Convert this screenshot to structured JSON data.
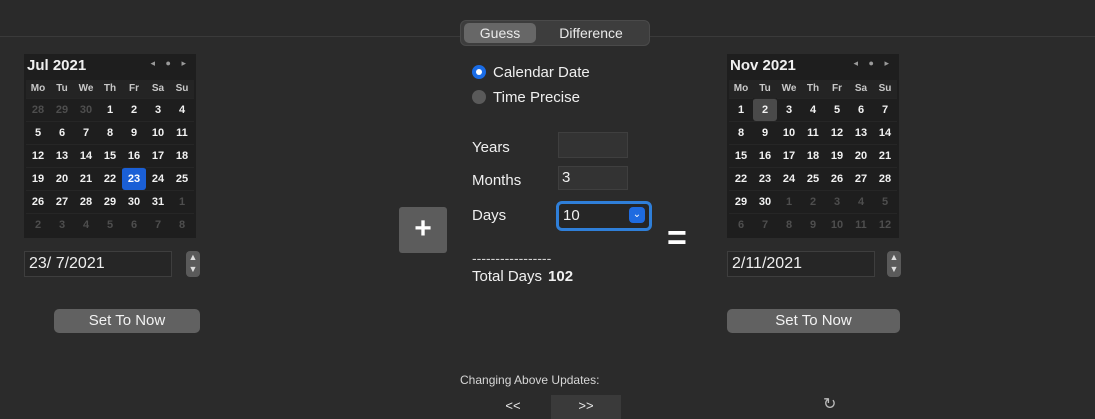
{
  "tabs": {
    "guess": "Guess",
    "difference": "Difference"
  },
  "left_calendar": {
    "month_label": "Jul 2021",
    "nav": "◂ ● ▸",
    "day_names": [
      "Mo",
      "Tu",
      "We",
      "Th",
      "Fr",
      "Sa",
      "Su"
    ],
    "weeks": [
      [
        "28",
        "29",
        "30",
        "1",
        "2",
        "3",
        "4"
      ],
      [
        "5",
        "6",
        "7",
        "8",
        "9",
        "10",
        "11"
      ],
      [
        "12",
        "13",
        "14",
        "15",
        "16",
        "17",
        "18"
      ],
      [
        "19",
        "20",
        "21",
        "22",
        "23",
        "24",
        "25"
      ],
      [
        "26",
        "27",
        "28",
        "29",
        "30",
        "31",
        "1"
      ],
      [
        "2",
        "3",
        "4",
        "5",
        "6",
        "7",
        "8"
      ]
    ],
    "selected_day": "23",
    "date_field": "23/ 7/2021",
    "set_to_now": "Set To Now"
  },
  "right_calendar": {
    "month_label": "Nov 2021",
    "nav": "◂ ● ▸",
    "day_names": [
      "Mo",
      "Tu",
      "We",
      "Th",
      "Fr",
      "Sa",
      "Su"
    ],
    "weeks": [
      [
        "1",
        "2",
        "3",
        "4",
        "5",
        "6",
        "7"
      ],
      [
        "8",
        "9",
        "10",
        "11",
        "12",
        "13",
        "14"
      ],
      [
        "15",
        "16",
        "17",
        "18",
        "19",
        "20",
        "21"
      ],
      [
        "22",
        "23",
        "24",
        "25",
        "26",
        "27",
        "28"
      ],
      [
        "29",
        "30",
        "1",
        "2",
        "3",
        "4",
        "5"
      ],
      [
        "6",
        "7",
        "8",
        "9",
        "10",
        "11",
        "12"
      ]
    ],
    "today_day": "2",
    "date_field": "2/11/2021",
    "set_to_now": "Set To Now"
  },
  "mode": {
    "calendar_date": "Calendar Date",
    "time_precise": "Time Precise"
  },
  "fields": {
    "years_label": "Years",
    "years_value": "",
    "months_label": "Months",
    "months_value": "3",
    "days_label": "Days",
    "days_value": "10"
  },
  "operator_plus": "+",
  "operator_equals": "=",
  "separator": "-----------------",
  "total": {
    "label": "Total Days",
    "value": "102"
  },
  "footer": {
    "changing_label": "Changing Above Updates:",
    "left": "<<",
    "right": ">>"
  },
  "colors": {
    "accent": "#1a6ce6",
    "background": "#2b2b2b"
  }
}
